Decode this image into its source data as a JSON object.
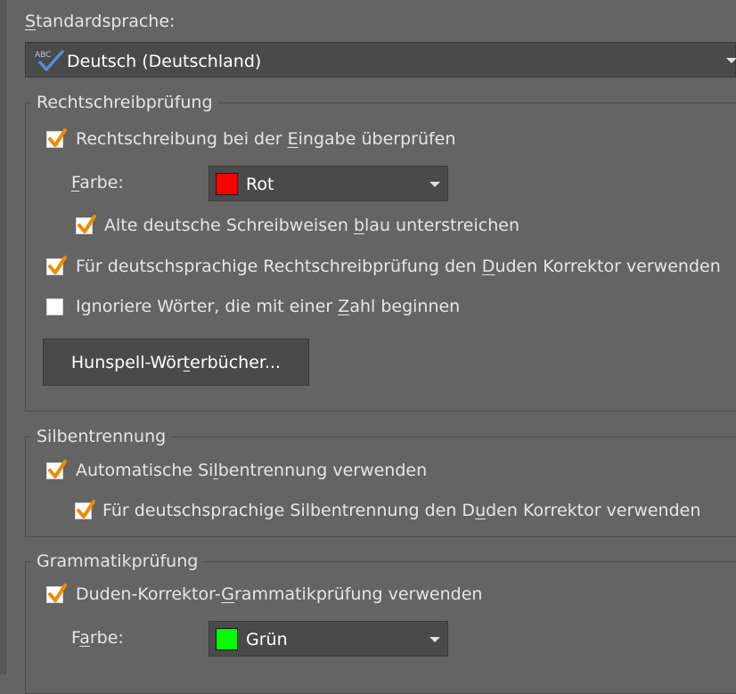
{
  "default_language": {
    "label_pre": "",
    "label_u": "S",
    "label_post": "tandardsprache:",
    "value": "Deutsch (Deutschland)",
    "icon": "abc-checkmark-icon"
  },
  "spelling": {
    "title": "Rechtschreibprüfung",
    "check_as_type": {
      "pre": "Rechtschreibung bei der ",
      "u": "E",
      "post": "ingabe überprüfen",
      "checked": true
    },
    "color": {
      "label_pre": "",
      "label_u": "F",
      "label_post": "arbe:",
      "value": "Rot",
      "swatch": "#ff0000"
    },
    "old_spelling": {
      "pre": "Alte deutsche Schreibweisen ",
      "u": "b",
      "post": "lau unterstreichen",
      "checked": true
    },
    "use_duden": {
      "pre": "Für deutschsprachige Rechtschreibprüfung den ",
      "u": "D",
      "post": "uden Korrektor verwenden",
      "checked": true
    },
    "ignore_numbers": {
      "pre": "Ignoriere Wörter, die mit einer ",
      "u": "Z",
      "post": "ahl beginnen",
      "checked": false
    },
    "hunspell_button": {
      "pre": "Hunspell-Wör",
      "u": "t",
      "post": "erbücher..."
    }
  },
  "hyphenation": {
    "title": "Silbentrennung",
    "auto": {
      "pre": "Automatische Si",
      "u": "l",
      "post": "bentrennung verwenden",
      "checked": true
    },
    "use_duden": {
      "pre": "Für deutschsprachige Silbentrennung den D",
      "u": "u",
      "post": "den Korrektor verwenden",
      "checked": true
    }
  },
  "grammar": {
    "title": "Grammatikprüfung",
    "use_duden": {
      "pre": "Duden-Korrektor-",
      "u": "G",
      "post": "rammatikprüfung verwenden",
      "checked": true
    },
    "color": {
      "label_pre": "F",
      "label_u": "a",
      "label_post": "rbe:",
      "value": "Grün",
      "swatch": "#00ff00"
    }
  },
  "colors": {
    "accent_check": "#f08a00",
    "swatch_red": "#ff0000",
    "swatch_green": "#00ff00"
  }
}
